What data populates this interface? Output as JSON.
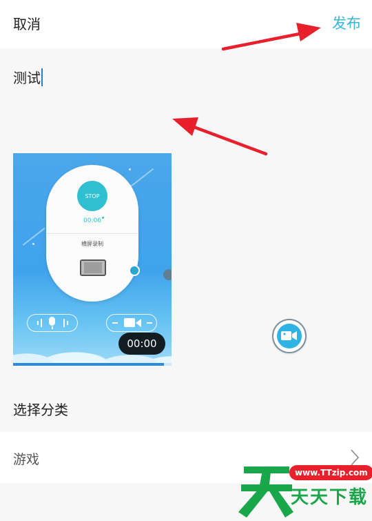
{
  "header": {
    "cancel_label": "取消",
    "publish_label": "发布"
  },
  "editor": {
    "text_value": "测试"
  },
  "video": {
    "stop_label": "STOP",
    "recording_time": "00:06",
    "mode_label": "横屏录制",
    "duration": "00:00",
    "progress_percent": 95
  },
  "category": {
    "title": "选择分类",
    "value": "游戏"
  },
  "watermark": {
    "url": "www.TTzip.com",
    "text": "天天下载"
  },
  "colors": {
    "accent": "#35b6d6",
    "annotation_arrow": "#e8202b",
    "watermark_green": "#1aa64a"
  },
  "icons": {
    "float_button": "video-camera-icon",
    "category_arrow": "chevron-right-icon"
  }
}
